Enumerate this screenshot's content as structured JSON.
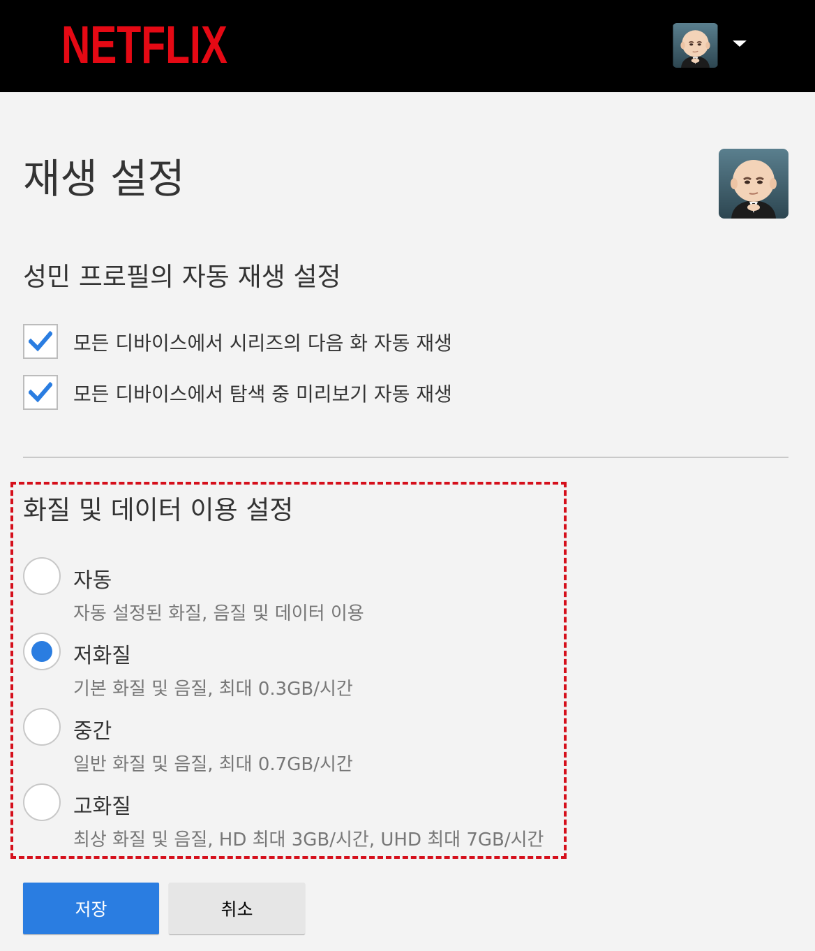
{
  "header": {
    "logo_text": "NETFLIX",
    "brand_color": "#e50914",
    "avatar_icon": "boss-baby-avatar",
    "menu_icon": "caret-down-icon"
  },
  "page": {
    "title": "재생 설정",
    "profile_avatar_icon": "boss-baby-avatar"
  },
  "autoplay": {
    "title": "성민 프로필의 자동 재생 설정",
    "options": [
      {
        "label": "모든 디바이스에서 시리즈의 다음 화 자동 재생",
        "checked": true
      },
      {
        "label": "모든 디바이스에서 탐색 중 미리보기 자동 재생",
        "checked": true
      }
    ]
  },
  "quality": {
    "title": "화질 및 데이터 이용 설정",
    "highlight_color": "#d50f1b",
    "selected_index": 1,
    "options": [
      {
        "label": "자동",
        "desc": "자동 설정된 화질, 음질 및 데이터 이용"
      },
      {
        "label": "저화질",
        "desc": "기본 화질 및 음질, 최대 0.3GB/시간"
      },
      {
        "label": "중간",
        "desc": "일반 화질 및 음질, 최대 0.7GB/시간"
      },
      {
        "label": "고화질",
        "desc": "최상 화질 및 음질, HD 최대 3GB/시간, UHD 최대 7GB/시간"
      }
    ]
  },
  "buttons": {
    "save_label": "저장",
    "cancel_label": "취소",
    "save_color": "#2a7de1"
  }
}
